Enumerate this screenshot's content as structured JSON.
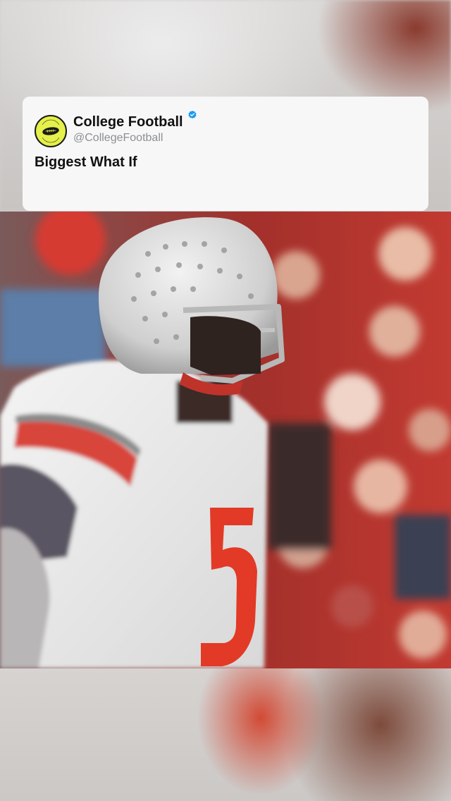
{
  "post": {
    "display_name": "College Football",
    "handle": "@CollegeFootball",
    "verified_icon": "verified-badge-icon",
    "text": "Biggest What If",
    "avatar_text": "COLLEGE FOOTBALL"
  },
  "video": {
    "description_icon": "video-frame",
    "jersey_number": "5"
  },
  "colors": {
    "card_background": "#f7f7f7",
    "verified": "#1d9bf0",
    "handle": "#8a8f95",
    "avatar": "#e5f04a",
    "jersey_number": "#e23a26"
  }
}
